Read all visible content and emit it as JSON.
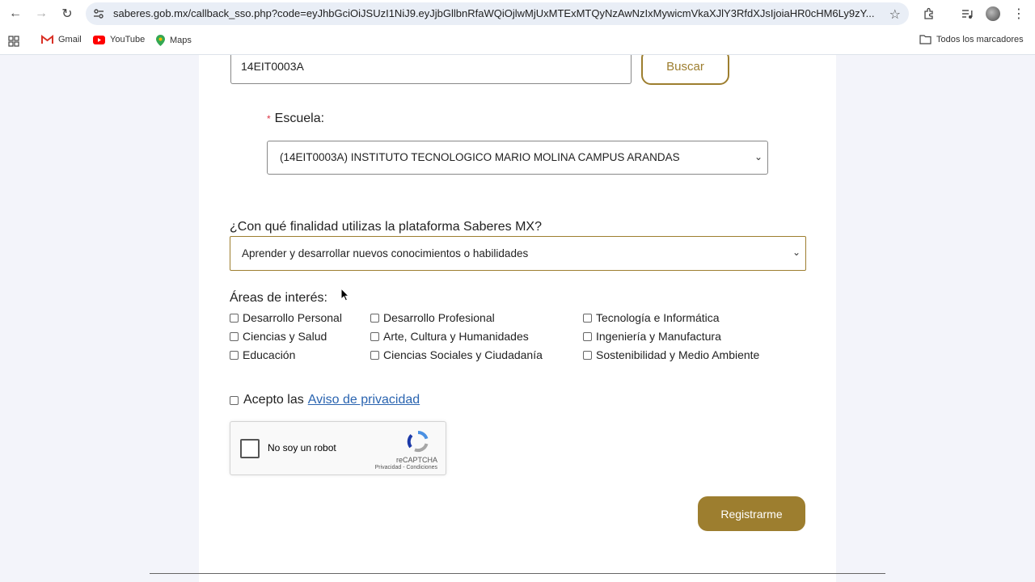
{
  "browser": {
    "url": "saberes.gob.mx/callback_sso.php?code=eyJhbGciOiJSUzI1NiJ9.eyJjbGllbnRfaWQiOjlwMjUxMTExMTQyNzAwNzIxMywicmVkaXJlY3RfdXJsIjoiaHR0cHM6Ly9zY...",
    "bookmarks": [
      {
        "label": "Gmail"
      },
      {
        "label": "YouTube"
      },
      {
        "label": "Maps"
      }
    ],
    "all_bookmarks": "Todos los marcadores"
  },
  "form": {
    "clave_value": "14EIT0003A",
    "buscar_label": "Buscar",
    "escuela_label": "Escuela:",
    "required_mark": "*",
    "escuela_value": "(14EIT0003A) INSTITUTO TECNOLOGICO MARIO MOLINA CAMPUS ARANDAS",
    "finalidad_label": "¿Con qué finalidad utilizas la plataforma Saberes MX?",
    "finalidad_value": "Aprender y desarrollar nuevos conocimientos o habilidades",
    "areas_label": "Áreas de interés:",
    "areas": [
      "Desarrollo Personal",
      "Desarrollo Profesional",
      "Tecnología e Informática",
      "Ciencias y Salud",
      "Arte, Cultura y Humanidades",
      "Ingeniería y Manufactura",
      "Educación",
      "Ciencias Sociales y Ciudadanía",
      "Sostenibilidad y Medio Ambiente"
    ],
    "privacy_prefix": "Acepto las",
    "privacy_link": "Aviso de privacidad",
    "captcha_label": "No soy un robot",
    "captcha_brand": "reCAPTCHA",
    "captcha_links": "Privacidad - Condiciones",
    "register_label": "Registrarme"
  },
  "colors": {
    "accent_gold": "#9d7e2f",
    "link_blue": "#2a64b0",
    "required_red": "#dc3545"
  }
}
